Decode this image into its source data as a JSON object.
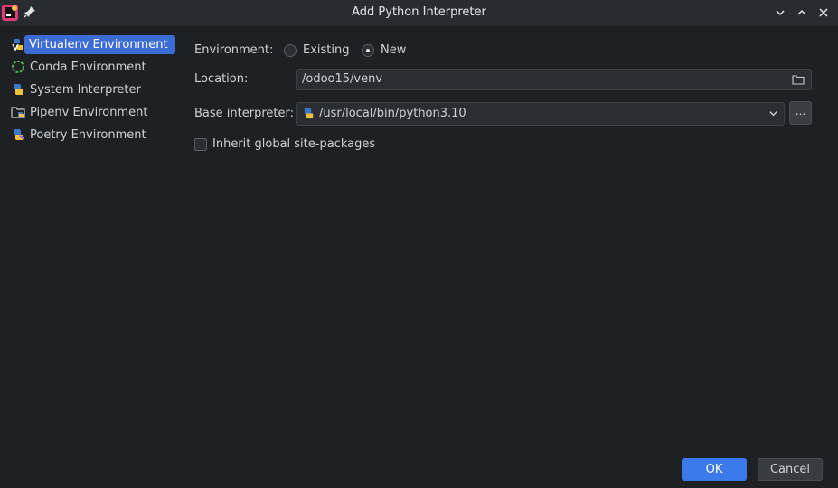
{
  "window": {
    "title": "Add Python Interpreter",
    "controls": [
      "minimize",
      "maximize",
      "close"
    ]
  },
  "sidebar": {
    "items": [
      {
        "label": "Virtualenv Environment",
        "icon": "virtualenv-icon",
        "selected": true
      },
      {
        "label": "Conda Environment",
        "icon": "conda-icon",
        "selected": false
      },
      {
        "label": "System Interpreter",
        "icon": "python-icon",
        "selected": false
      },
      {
        "label": "Pipenv Environment",
        "icon": "pipenv-icon",
        "selected": false
      },
      {
        "label": "Poetry Environment",
        "icon": "poetry-icon",
        "selected": false
      }
    ]
  },
  "form": {
    "environment_label": "Environment:",
    "env_options": [
      {
        "label": "Existing",
        "checked": false
      },
      {
        "label": "New",
        "checked": true
      }
    ],
    "location_label": "Location:",
    "location_value": "/odoo15/venv",
    "base_interpreter_label": "Base interpreter:",
    "base_interpreter_value": "/usr/local/bin/python3.10",
    "browse_label": "...",
    "inherit_label": "Inherit global site-packages",
    "inherit_checked": false
  },
  "buttons": {
    "ok": "OK",
    "cancel": "Cancel"
  },
  "colors": {
    "accent": "#3b6cd4",
    "background": "#1f2024"
  }
}
